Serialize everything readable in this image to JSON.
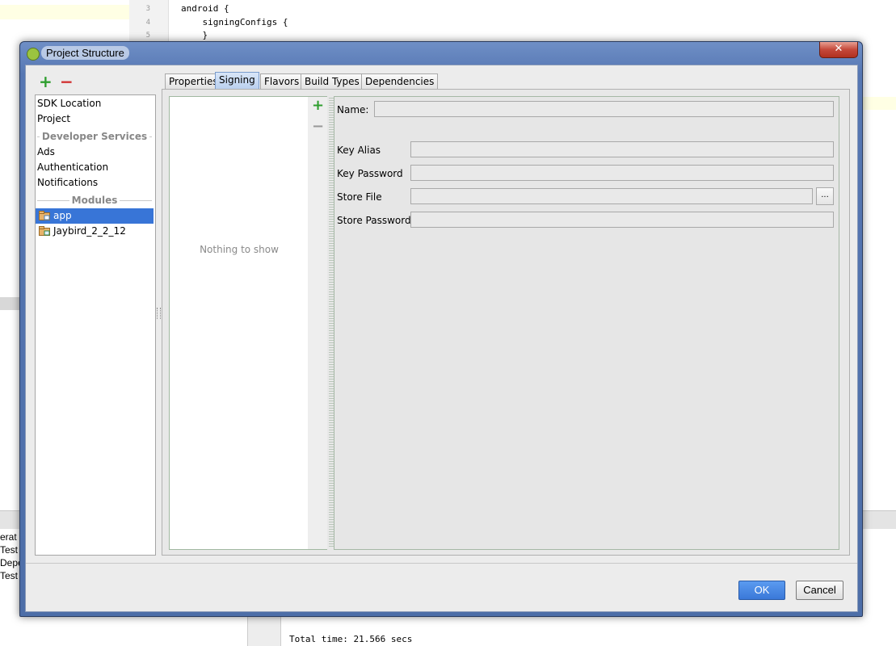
{
  "ide": {
    "line_numbers": [
      "3",
      "4",
      "5"
    ],
    "code_lines": [
      "android {",
      "    signingConfigs {",
      "    }"
    ],
    "console_lines": [
      "erat",
      "Test",
      "Depe",
      "Test"
    ],
    "total_time": "Total time: 21.566 secs"
  },
  "dialog": {
    "title": "Project Structure",
    "close_label": "✕",
    "toolbar": {
      "add": "+",
      "remove": "−"
    },
    "nav": {
      "items_top": [
        "SDK Location",
        "Project"
      ],
      "section_developer_services": "Developer Services",
      "items_services": [
        "Ads",
        "Authentication",
        "Notifications"
      ],
      "section_modules": "Modules",
      "modules": [
        "app",
        "Jaybird_2_2_12"
      ],
      "selected_module": "app"
    },
    "tabs": [
      "Properties",
      "Signing",
      "Flavors",
      "Build Types",
      "Dependencies"
    ],
    "active_tab": "Signing",
    "signing": {
      "empty_text": "Nothing to show",
      "list_add": "+",
      "list_remove": "−",
      "fields": {
        "name_label": "Name:",
        "key_alias_label": "Key Alias",
        "key_password_label": "Key Password",
        "store_file_label": "Store File",
        "store_password_label": "Store Password",
        "name_value": "",
        "key_alias_value": "",
        "key_password_value": "",
        "store_file_value": "",
        "store_password_value": ""
      },
      "browse_label": "..."
    },
    "buttons": {
      "ok": "OK",
      "cancel": "Cancel"
    }
  },
  "colors": {
    "selection": "#3875d7",
    "ok_button": "#3a78d8",
    "add_icon": "#2e9e2e",
    "remove_icon": "#d13030"
  }
}
